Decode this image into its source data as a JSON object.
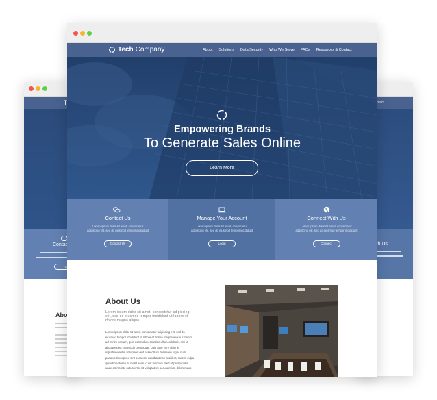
{
  "brand": {
    "name_bold": "Tech",
    "name_light": "Company"
  },
  "nav": [
    "About",
    "Solutions",
    "Data Security",
    "Who We Serve",
    "FAQs",
    "Resources & Contact"
  ],
  "hero": {
    "title": "Empowering Brands",
    "subtitle": "To Generate Sales Online",
    "cta": "Learn More"
  },
  "features": [
    {
      "title": "Contact Us",
      "desc1": "Lorem ipsum dolor sit amet, consectetur",
      "desc2": "adipiscing elit, sed do eiusmod tempor incididunt",
      "button": "Contact Us",
      "icon": "chat-icon"
    },
    {
      "title": "Manage Your Account",
      "desc1": "Lorem ipsum dolor sit amet, consectetur",
      "desc2": "adipiscing elit, sed do eiusmod tempor incididunt",
      "button": "Login",
      "icon": "laptop-icon"
    },
    {
      "title": "Connect With Us",
      "desc1": "Lorem ipsum dolor sit amet, consectetur",
      "desc2": "adipiscing elit, sed do eiusmod tempor incididunt",
      "button": "Connect",
      "icon": "globe-icon"
    }
  ],
  "about": {
    "title": "About Us",
    "lead": [
      "Lorem ipsum dolor sit amet, consectetur adipiscing",
      "elit, sed do eiusmod tempor incididunt ut labore et",
      "dolore magna aliqua."
    ],
    "body": [
      "Lorem ipsum dolor sit amet, consectetur adipiscing elit, sed do",
      "eiusmod tempor incididunt ut labore et dolore magna aliqua. Ut enim",
      "ad minim veniam, quis nostrud exercitation ullamco laboris nisi ut",
      "aliquip ex ea commodo consequat. Duis aute irure dolor in",
      "reprehenderit in voluptate velit esse cillum dolore eu fugiat nulla",
      "pariatur. Excepteur sint occaecat cupidatat non proident, sunt in culpa",
      "qui officia deserunt mollit anim id est laborum. Sed ut perspiciatis",
      "unde omnis iste natus error sit voluptatem accusantium doloremque"
    ]
  },
  "back_window": {
    "left_contact": "Contac",
    "left_about": "Abo",
    "left_btn": "Conta",
    "right_label": "ith Us",
    "right_nav": "ntact"
  },
  "colors": {
    "nav": "#4a6290",
    "hero": "#274775",
    "panel_mid": "#5071a2",
    "panel_side": "#6280b1",
    "red": "#f4564a",
    "yellow": "#f6b62b",
    "green": "#5fcf4a"
  }
}
